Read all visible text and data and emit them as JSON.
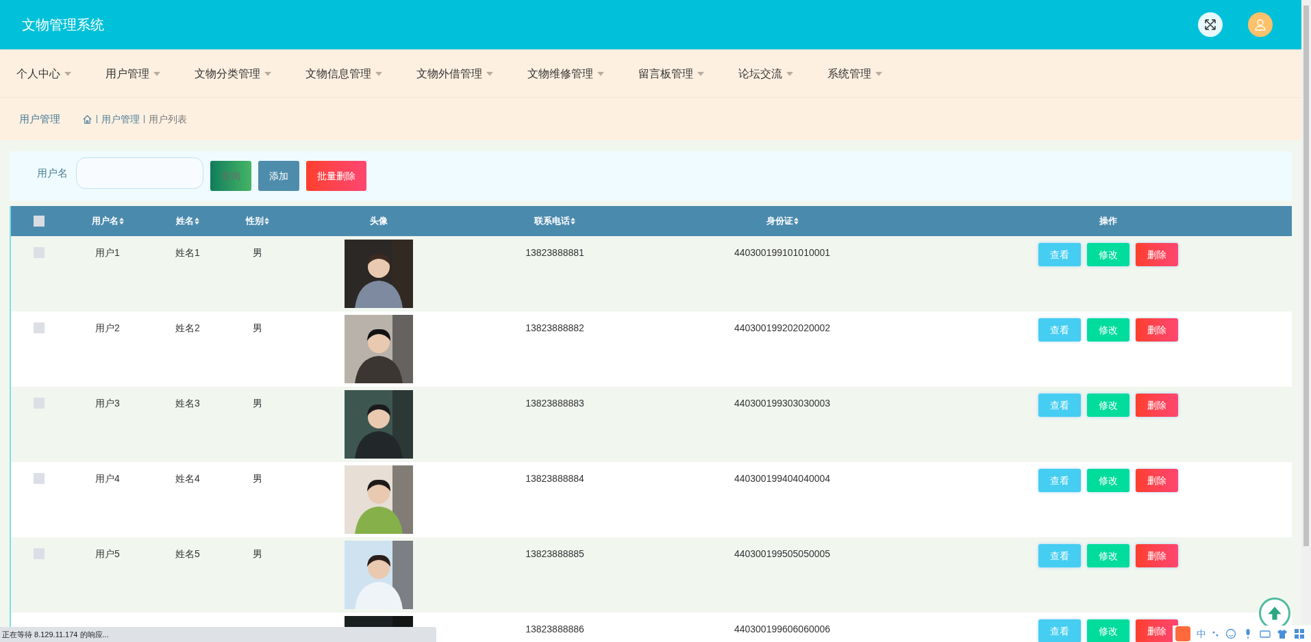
{
  "header": {
    "title": "文物管理系统"
  },
  "nav": [
    {
      "label": "个人中心"
    },
    {
      "label": "用户管理"
    },
    {
      "label": "文物分类管理"
    },
    {
      "label": "文物信息管理"
    },
    {
      "label": "文物外借管理"
    },
    {
      "label": "文物维修管理"
    },
    {
      "label": "留言板管理"
    },
    {
      "label": "论坛交流"
    },
    {
      "label": "系统管理"
    }
  ],
  "breadcrumb": {
    "title": "用户管理",
    "path": [
      "用户管理",
      "用户列表"
    ]
  },
  "search": {
    "label": "用户名",
    "buttons": [
      {
        "label": "查询",
        "kind": "query"
      },
      {
        "label": "添加",
        "kind": "add"
      },
      {
        "label": "批量删除",
        "kind": "delete"
      }
    ]
  },
  "table": {
    "select_all_checked": false,
    "columns": [
      {
        "label": "用户名",
        "sortable": true
      },
      {
        "label": "姓名",
        "sortable": true
      },
      {
        "label": "性别",
        "sortable": true
      },
      {
        "label": "头像",
        "sortable": false
      },
      {
        "label": "联系电话",
        "sortable": true
      },
      {
        "label": "身份证",
        "sortable": true
      },
      {
        "label": "操作",
        "sortable": false
      }
    ],
    "rows": [
      {
        "checked": false,
        "username": "用户1",
        "name": "姓名1",
        "gender": "男",
        "phone": "13823888881",
        "id_card": "440300199101010001",
        "actions": [
          "查看",
          "修改",
          "删除"
        ]
      },
      {
        "checked": false,
        "username": "用户2",
        "name": "姓名2",
        "gender": "男",
        "phone": "13823888882",
        "id_card": "440300199202020002",
        "actions": [
          "查看",
          "修改",
          "删除"
        ]
      },
      {
        "checked": false,
        "username": "用户3",
        "name": "姓名3",
        "gender": "男",
        "phone": "13823888883",
        "id_card": "440300199303030003",
        "actions": [
          "查看",
          "修改",
          "删除"
        ]
      },
      {
        "checked": false,
        "username": "用户4",
        "name": "姓名4",
        "gender": "男",
        "phone": "13823888884",
        "id_card": "440300199404040004",
        "actions": [
          "查看",
          "修改",
          "删除"
        ]
      },
      {
        "checked": false,
        "username": "用户5",
        "name": "姓名5",
        "gender": "男",
        "phone": "13823888885",
        "id_card": "440300199505050005",
        "actions": [
          "查看",
          "修改",
          "删除"
        ]
      },
      {
        "phone": "13823888886",
        "id_card": "440300199606060006",
        "actions": [
          "查看",
          "修改",
          "删除"
        ]
      }
    ]
  },
  "status_bar": {
    "text": "正在等待 8.129.11.174 的响应..."
  },
  "ime_bar": {
    "label": "中"
  }
}
